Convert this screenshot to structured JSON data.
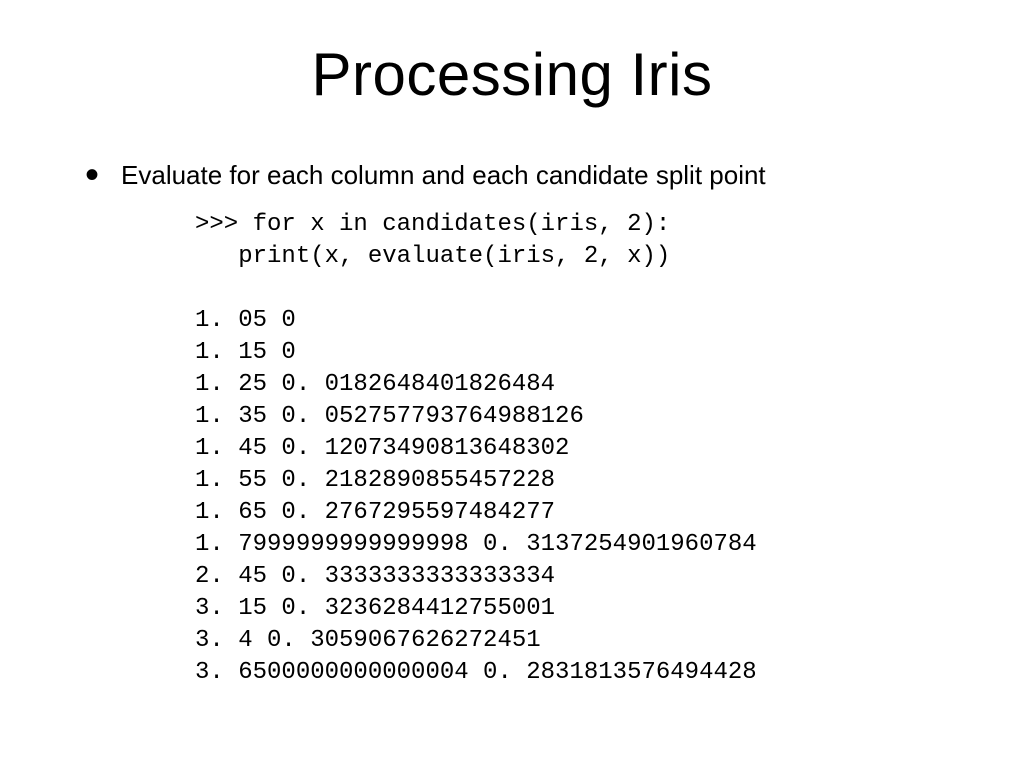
{
  "title": "Processing Iris",
  "bullet": "Evaluate for each column and each candidate split point",
  "code": {
    "line1": ">>> for x in candidates(iris, 2):",
    "line2": "   print(x, evaluate(iris, 2, x))"
  },
  "output": [
    "1. 05 0",
    "1. 15 0",
    "1. 25 0. 0182648401826484",
    "1. 35 0. 052757793764988126",
    "1. 45 0. 12073490813648302",
    "1. 55 0. 2182890855457228",
    "1. 65 0. 2767295597484277",
    "1. 7999999999999998 0. 3137254901960784",
    "2. 45 0. 3333333333333334",
    "3. 15 0. 3236284412755001",
    "3. 4 0. 3059067626272451",
    "3. 6500000000000004 0. 2831813576494428"
  ]
}
